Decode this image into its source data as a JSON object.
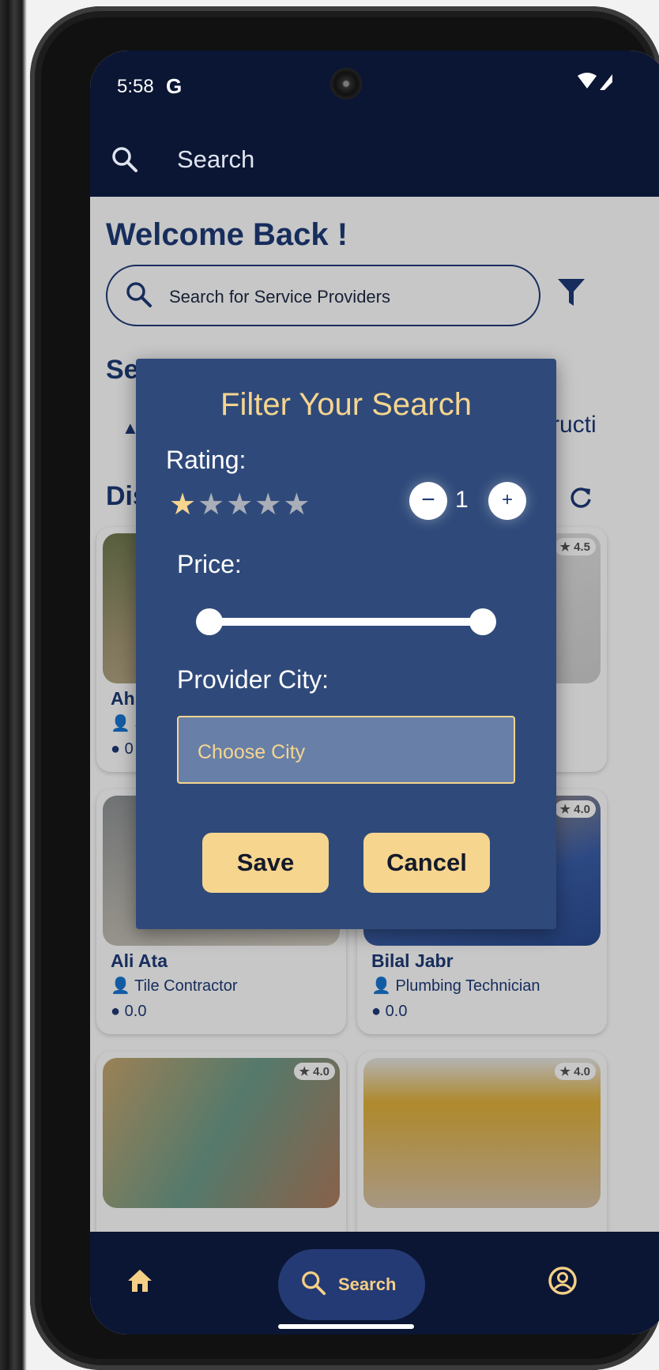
{
  "status_bar": {
    "time": "5:58",
    "g_icon": "G",
    "icons": "wifi-icon signal-icon"
  },
  "app_bar": {
    "search_label": "Search"
  },
  "home": {
    "welcome": "Welcome Back !",
    "search_placeholder": "Search for Service Providers",
    "services_title": "Services",
    "services_partial_right": "ructi",
    "discover_partial": "Dis"
  },
  "cards": [
    {
      "name": "Ahm",
      "role": "S",
      "price": "0",
      "badge": ""
    },
    {
      "name": "",
      "role": "",
      "price": "",
      "badge": "4.5"
    },
    {
      "name": "Ali Ata",
      "role": "Tile Contractor",
      "price": "0.0",
      "badge": ""
    },
    {
      "name": "Bilal Jabr",
      "role": "Plumbing Technician",
      "price": "0.0",
      "badge": "4.0"
    },
    {
      "name": "",
      "role": "",
      "price": "",
      "badge": "4.0"
    },
    {
      "name": "",
      "role": "",
      "price": "",
      "badge": "4.0"
    }
  ],
  "dialog": {
    "title": "Filter Your Search",
    "rating_label": "Rating:",
    "rating_value": "1",
    "stars_total": 5,
    "stars_filled": 1,
    "price_label": "Price:",
    "price_range": [
      0,
      1
    ],
    "city_label": "Provider City:",
    "city_placeholder": "Choose City",
    "save": "Save",
    "cancel": "Cancel",
    "minus": "−",
    "plus": "+"
  },
  "bottom_nav": {
    "search_label": "Search"
  },
  "colors": {
    "navy": "#0b1634",
    "dialog": "#2f4a7a",
    "accent": "#f6d58f"
  }
}
